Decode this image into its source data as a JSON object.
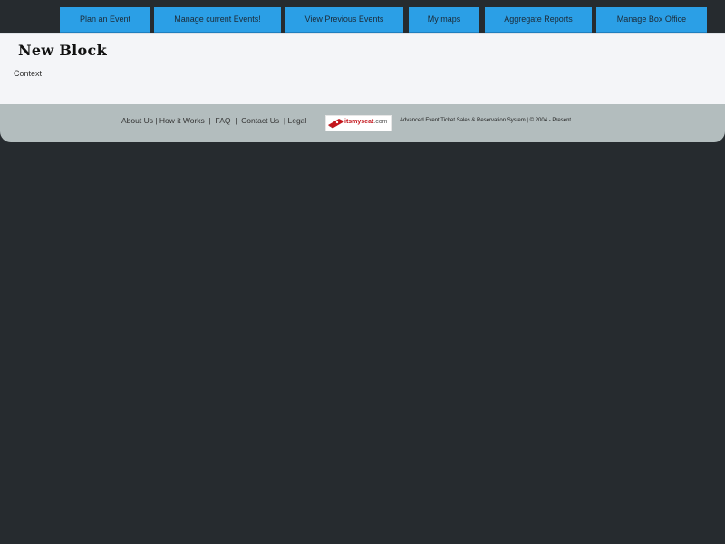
{
  "nav": {
    "items": [
      {
        "label": "Plan an Event"
      },
      {
        "label": "Manage current Events!"
      },
      {
        "label": "View Previous Events"
      },
      {
        "label": "My maps"
      },
      {
        "label": "Aggregate Reports"
      },
      {
        "label": "Manage Box Office"
      }
    ]
  },
  "block": {
    "title": "New Block",
    "text": "Context"
  },
  "footer": {
    "links": [
      {
        "label": "About Us"
      },
      {
        "label": "How it Works"
      },
      {
        "label": "FAQ"
      },
      {
        "label": "Contact Us"
      },
      {
        "label": "Legal"
      }
    ],
    "logo": {
      "name": "itsmyseat",
      "tld": ".com",
      "icon": "ticket-icon"
    },
    "tagline": "Advanced Event Ticket Sales & Reservation System | © 2004 - Present"
  },
  "colors": {
    "page_bg": "#262b2f",
    "nav_button": "#2b9fe6",
    "content_bg": "#f4f5f8",
    "footer_bg": "#b3bdbe",
    "logo_red": "#c4161c"
  }
}
